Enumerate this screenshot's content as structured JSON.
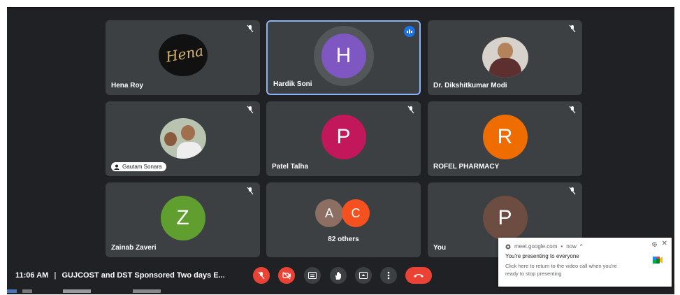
{
  "participants": {
    "hena": {
      "name": "Hena Roy",
      "signature": "Hena"
    },
    "hardik": {
      "name": "Hardik Soni",
      "initial": "H",
      "color": "#7e57c2"
    },
    "dikshit": {
      "name": "Dr. Dikshitkumar Modi"
    },
    "gautam": {
      "name": "Gautam Sonara"
    },
    "patel": {
      "name": "Patel Talha",
      "initial": "P",
      "color": "#c2185b"
    },
    "rofel": {
      "name": "ROFEL PHARMACY",
      "initial": "R",
      "color": "#ef6c00"
    },
    "zainab": {
      "name": "Zainab Zaveri",
      "initial": "Z",
      "color": "#5f9e2f"
    },
    "others": {
      "count_label": "82 others",
      "initial_a": "A",
      "color_a": "#8d6e63",
      "initial_c": "C",
      "color_c": "#f4511e"
    },
    "you": {
      "name": "You",
      "initial": "P",
      "color": "#6d4c41"
    }
  },
  "bottom_bar": {
    "time": "11:06 AM",
    "separator": "|",
    "meeting_title": "GUJCOST and DST Sponsored Two days E...",
    "controls": [
      "mic-off-icon",
      "camera-off-icon",
      "captions-icon",
      "raise-hand-icon",
      "present-icon",
      "more-options-icon",
      "hang-up-icon"
    ]
  },
  "notification": {
    "source": "meet.google.com",
    "time": "now",
    "title": "You're presenting to everyone",
    "body": "Click here to return to the video call when you're ready to stop presenting"
  },
  "colors": {
    "tile_bg": "#3c4043",
    "active_border": "#8ab4f8",
    "danger": "#ea4335"
  }
}
